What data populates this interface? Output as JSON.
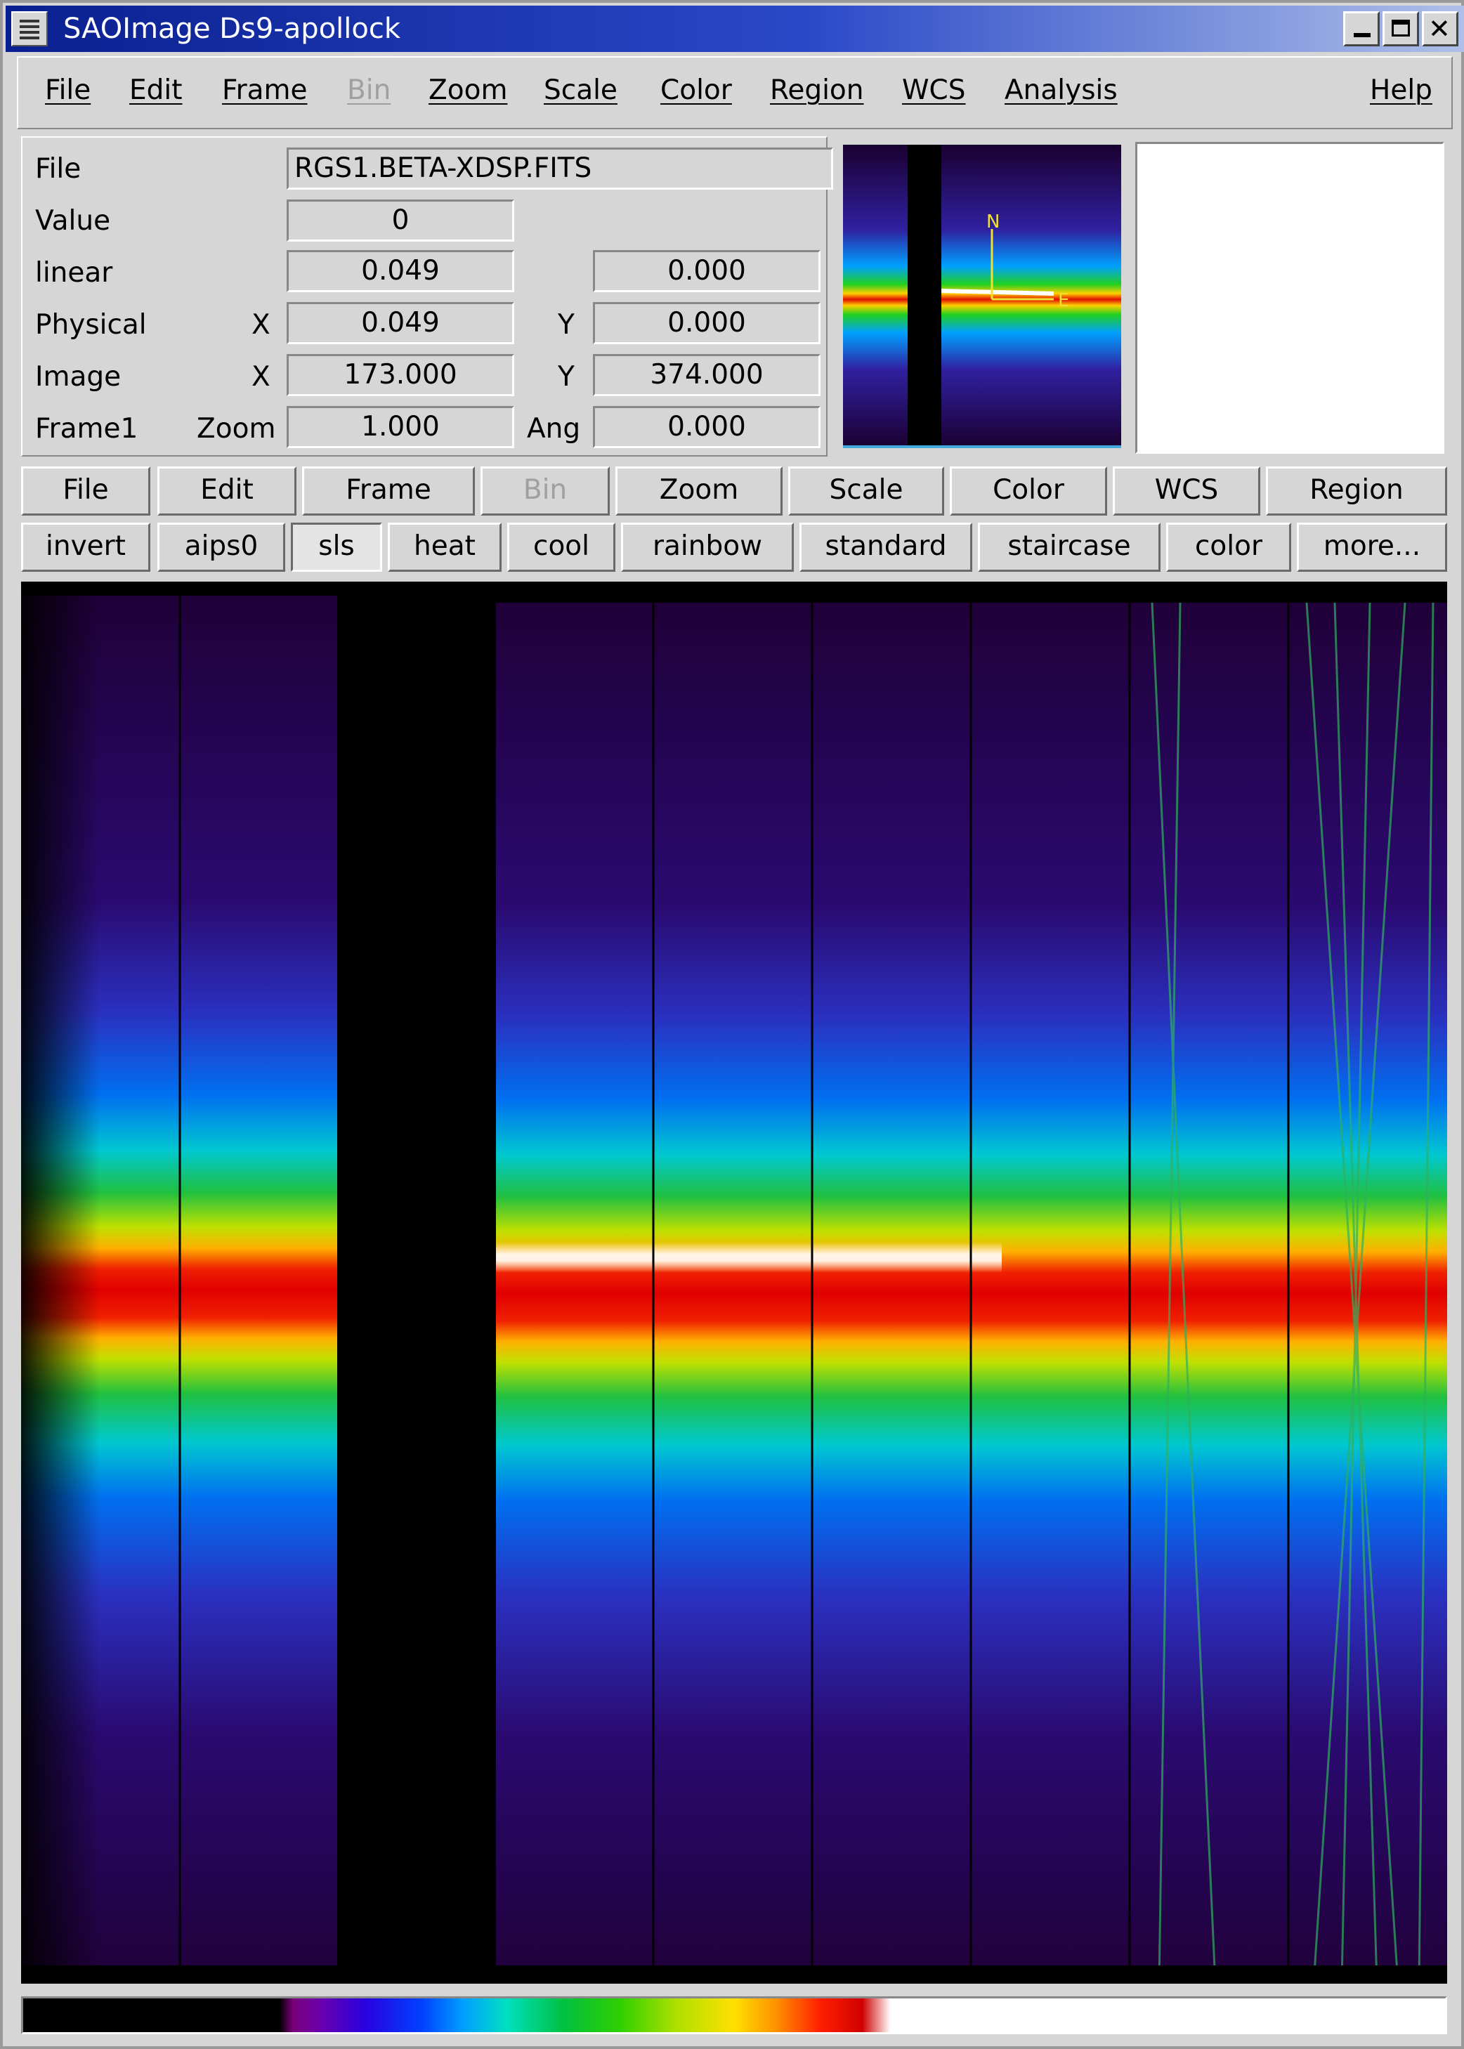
{
  "window": {
    "title": "SAOImage Ds9-apollock",
    "controls": [
      "minimize",
      "maximize",
      "close"
    ],
    "close_glyph": "✕"
  },
  "menubar": {
    "items": [
      {
        "label": "File",
        "enabled": true
      },
      {
        "label": "Edit",
        "enabled": true
      },
      {
        "label": "Frame",
        "enabled": true
      },
      {
        "label": "Bin",
        "enabled": false
      },
      {
        "label": "Zoom",
        "enabled": true
      },
      {
        "label": "Scale",
        "enabled": true
      },
      {
        "label": "Color",
        "enabled": true
      },
      {
        "label": "Region",
        "enabled": true
      },
      {
        "label": "WCS",
        "enabled": true
      },
      {
        "label": "Analysis",
        "enabled": true
      }
    ],
    "help": "Help"
  },
  "info": {
    "file_label": "File",
    "file_value": "RGS1.BETA-XDSP.FITS",
    "value_label": "Value",
    "value": "0",
    "linear_label": "linear",
    "linear_value1": "0.049",
    "linear_value2": "0.000",
    "physical_label": "Physical",
    "physical_x_label": "X",
    "physical_x": "0.049",
    "physical_y_label": "Y",
    "physical_y": "0.000",
    "image_label": "Image",
    "image_x_label": "X",
    "image_x": "173.000",
    "image_y_label": "Y",
    "image_y": "374.000",
    "frame_label": "Frame1",
    "zoom_label": "Zoom",
    "zoom_value": "1.000",
    "angle_label": "Ang",
    "angle_value": "0.000"
  },
  "panner": {
    "compass_north": "N",
    "compass_east": "E"
  },
  "buttonbar": {
    "items": [
      {
        "label": "File",
        "enabled": true
      },
      {
        "label": "Edit",
        "enabled": true
      },
      {
        "label": "Frame",
        "enabled": true
      },
      {
        "label": "Bin",
        "enabled": false
      },
      {
        "label": "Zoom",
        "enabled": true
      },
      {
        "label": "Scale",
        "enabled": true
      },
      {
        "label": "Color",
        "enabled": true
      },
      {
        "label": "WCS",
        "enabled": true
      },
      {
        "label": "Region",
        "enabled": true
      }
    ]
  },
  "colormaps": {
    "items": [
      "invert",
      "aips0",
      "sls",
      "heat",
      "cool",
      "rainbow",
      "standard",
      "staircase",
      "color",
      "more..."
    ],
    "selected": "sls"
  }
}
